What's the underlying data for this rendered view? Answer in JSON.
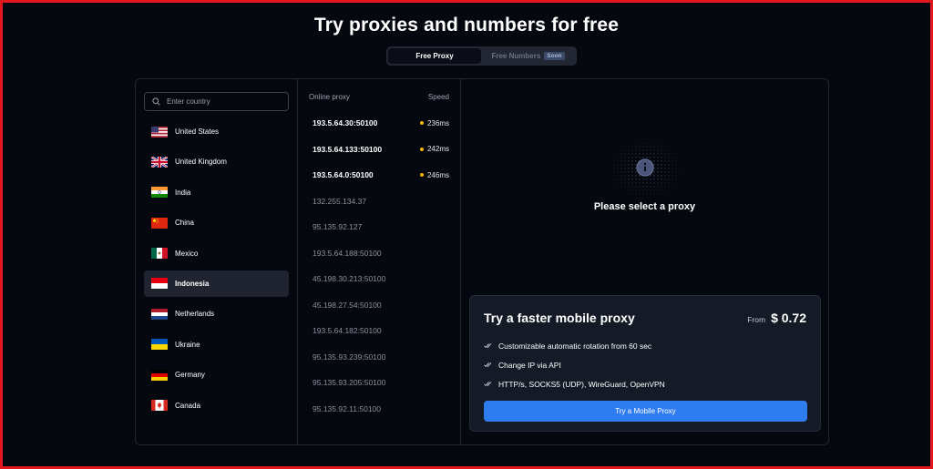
{
  "page_title": "Try proxies and numbers for free",
  "toggle": {
    "active": "Free Proxy",
    "inactive": "Free Numbers",
    "badge": "Soon"
  },
  "search": {
    "placeholder": "Enter country"
  },
  "countries": [
    {
      "name": "United States",
      "flag": "us"
    },
    {
      "name": "United Kingdom",
      "flag": "gb"
    },
    {
      "name": "India",
      "flag": "in"
    },
    {
      "name": "China",
      "flag": "cn"
    },
    {
      "name": "Mexico",
      "flag": "mx"
    },
    {
      "name": "Indonesia",
      "flag": "id",
      "selected": true
    },
    {
      "name": "Netherlands",
      "flag": "nl"
    },
    {
      "name": "Ukraine",
      "flag": "ua"
    },
    {
      "name": "Germany",
      "flag": "de"
    },
    {
      "name": "Canada",
      "flag": "ca"
    }
  ],
  "proxy_list": {
    "col_proxy": "Online proxy",
    "col_speed": "Speed",
    "rows": [
      {
        "ip": "193.5.64.30:50100",
        "speed": "236ms",
        "online": true
      },
      {
        "ip": "193.5.64.133:50100",
        "speed": "242ms",
        "online": true
      },
      {
        "ip": "193.5.64.0:50100",
        "speed": "246ms",
        "online": true
      },
      {
        "ip": "132.255.134.37",
        "speed": "",
        "online": false
      },
      {
        "ip": "95.135.92.127",
        "speed": "",
        "online": false
      },
      {
        "ip": "193.5.64.188:50100",
        "speed": "",
        "online": false
      },
      {
        "ip": "45.198.30.213:50100",
        "speed": "",
        "online": false
      },
      {
        "ip": "45.198.27.54:50100",
        "speed": "",
        "online": false
      },
      {
        "ip": "193.5.64.182:50100",
        "speed": "",
        "online": false
      },
      {
        "ip": "95.135.93.239:50100",
        "speed": "",
        "online": false
      },
      {
        "ip": "95.135.93.205:50100",
        "speed": "",
        "online": false
      },
      {
        "ip": "95.135.92.11:50100",
        "speed": "",
        "online": false
      }
    ]
  },
  "detail": {
    "message": "Please select a proxy",
    "icon": "info-icon"
  },
  "promo": {
    "title": "Try a faster mobile proxy",
    "price_from": "From",
    "price": "$ 0.72",
    "features": [
      "Customizable automatic rotation from 60 sec",
      "Change IP via API",
      "HTTP/s, SOCKS5 (UDP), WireGuard, OpenVPN"
    ],
    "button": "Try a Mobile Proxy"
  },
  "colors": {
    "accent": "#2f7bf0",
    "background": "#06080f",
    "speed_dot": "#f5b400",
    "frame": "#e3171e"
  }
}
